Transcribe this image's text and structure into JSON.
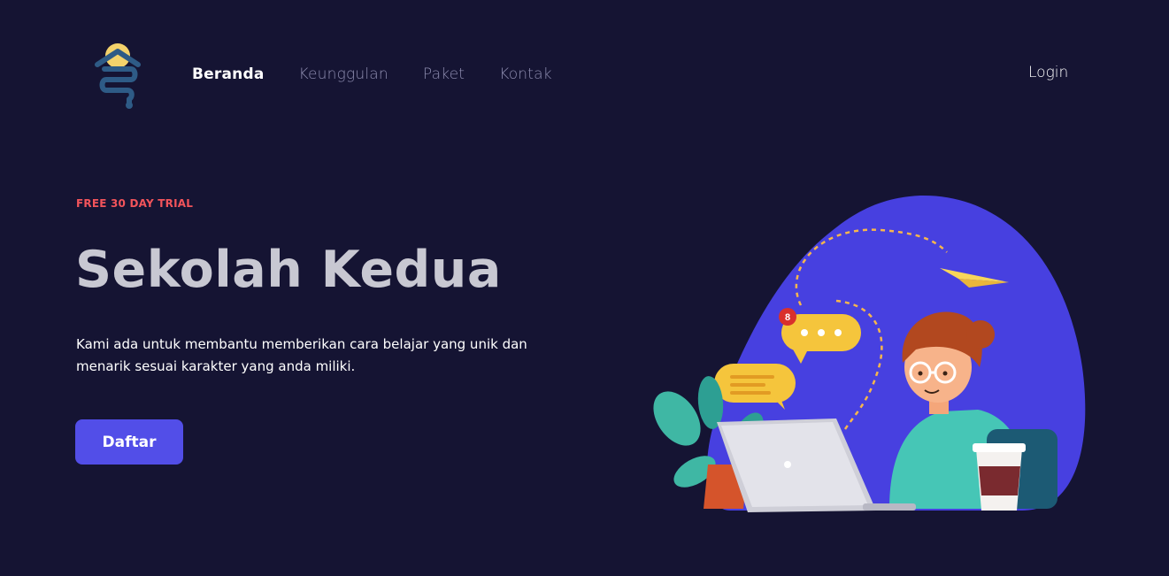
{
  "header": {
    "logo_icon": "sekolah-kedua-logo",
    "nav": [
      {
        "label": "Beranda",
        "active": true
      },
      {
        "label": "Keunggulan",
        "active": false
      },
      {
        "label": "Paket",
        "active": false
      },
      {
        "label": "Kontak",
        "active": false
      }
    ],
    "login_label": "Login"
  },
  "hero": {
    "badge": "FREE 30 DAY TRIAL",
    "title": "Sekolah Kedua",
    "description": "Kami ada untuk membantu memberikan cara belajar yang unik dan menarik sesuai karakter yang anda miliki.",
    "cta_label": "Daftar",
    "notification_count": "8"
  },
  "colors": {
    "background": "#151433",
    "accent": "#524ee8",
    "badge": "#f2545b",
    "title": "#c8c8d2",
    "nav_inactive": "#8e8db0"
  }
}
